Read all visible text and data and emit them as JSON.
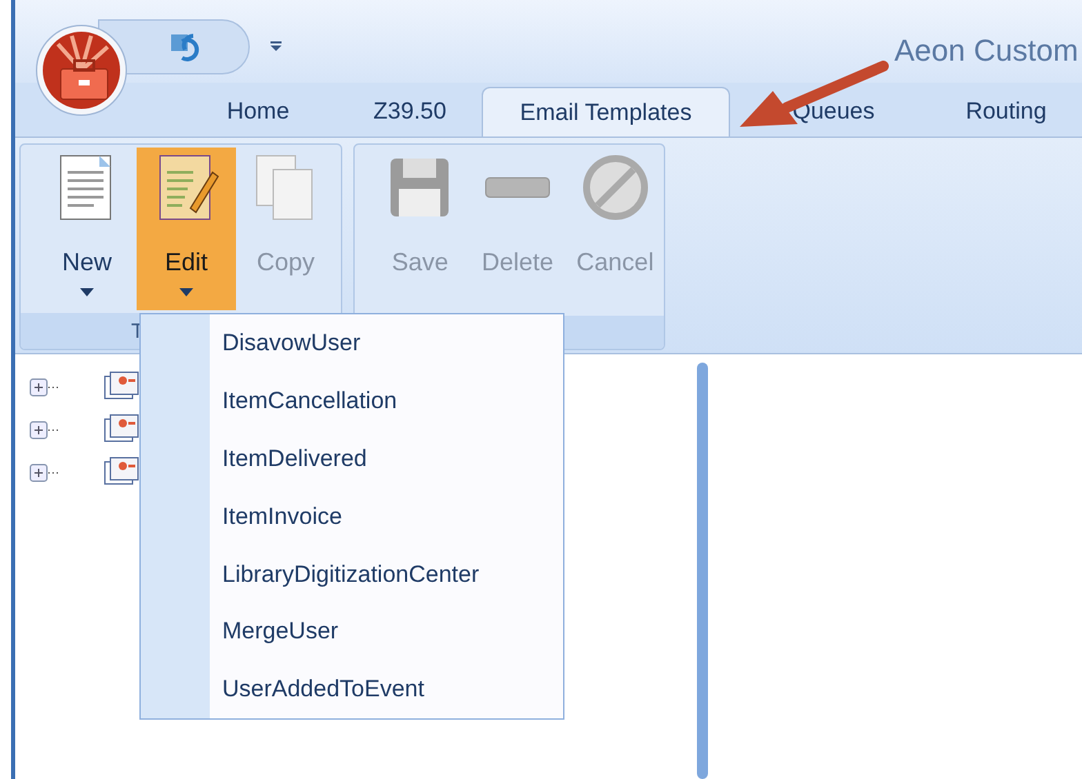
{
  "window": {
    "title": "Aeon Custom"
  },
  "tabs": [
    {
      "label": "Home",
      "selected": false
    },
    {
      "label": "Z39.50",
      "selected": false
    },
    {
      "label": "Email Templates",
      "selected": true
    },
    {
      "label": "Queues",
      "selected": false
    },
    {
      "label": "Routing",
      "selected": false
    }
  ],
  "ribbon": {
    "groups": [
      {
        "label": "T",
        "buttons": [
          {
            "kind": "new",
            "label": "New",
            "disabled": false,
            "dropdown": true,
            "pressed": false
          },
          {
            "kind": "edit",
            "label": "Edit",
            "disabled": false,
            "dropdown": true,
            "pressed": true
          },
          {
            "kind": "copy",
            "label": "Copy",
            "disabled": true,
            "dropdown": false,
            "pressed": false
          }
        ]
      },
      {
        "buttons": [
          {
            "kind": "save",
            "label": "Save",
            "disabled": true,
            "dropdown": false,
            "pressed": false
          },
          {
            "kind": "delete",
            "label": "Delete",
            "disabled": true,
            "dropdown": false,
            "pressed": false
          },
          {
            "kind": "cancel",
            "label": "Cancel",
            "disabled": true,
            "dropdown": false,
            "pressed": false
          }
        ]
      }
    ]
  },
  "tree": {
    "nodes": [
      {
        "expanded": false
      },
      {
        "expanded": false
      },
      {
        "expanded": false
      }
    ]
  },
  "edit_menu": {
    "items": [
      "DisavowUser",
      "ItemCancellation",
      "ItemDelivered",
      "ItemInvoice",
      "LibraryDigitizationCenter",
      "MergeUser",
      "UserAddedToEvent"
    ]
  }
}
